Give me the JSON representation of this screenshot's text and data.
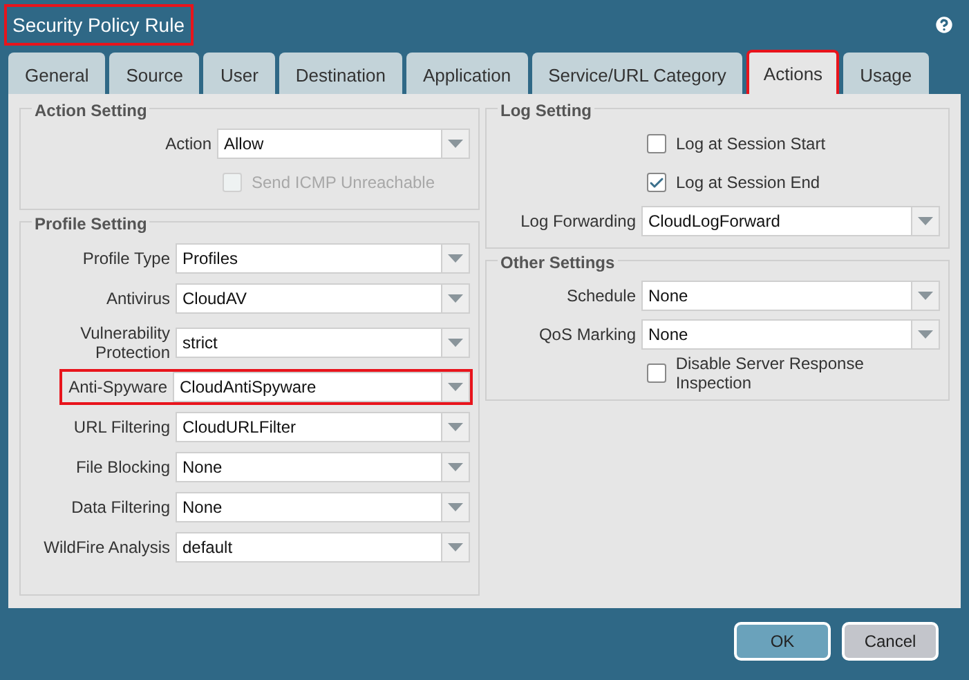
{
  "dialog": {
    "title": "Security Policy Rule",
    "highlighted": true
  },
  "tabs": [
    {
      "label": "General",
      "selected": false,
      "highlighted": false
    },
    {
      "label": "Source",
      "selected": false,
      "highlighted": false
    },
    {
      "label": "User",
      "selected": false,
      "highlighted": false
    },
    {
      "label": "Destination",
      "selected": false,
      "highlighted": false
    },
    {
      "label": "Application",
      "selected": false,
      "highlighted": false
    },
    {
      "label": "Service/URL Category",
      "selected": false,
      "highlighted": false
    },
    {
      "label": "Actions",
      "selected": true,
      "highlighted": true
    },
    {
      "label": "Usage",
      "selected": false,
      "highlighted": false
    }
  ],
  "action_setting": {
    "legend": "Action Setting",
    "action": {
      "label": "Action",
      "value": "Allow"
    },
    "checks": [
      {
        "label": "Send ICMP Unreachable",
        "checked": false,
        "disabled": true
      }
    ]
  },
  "profile_setting": {
    "legend": "Profile Setting",
    "rows": [
      {
        "label": "Profile Type",
        "value": "Profiles",
        "highlighted": false
      },
      {
        "label": "Antivirus",
        "value": "CloudAV",
        "highlighted": false
      },
      {
        "label": "Vulnerability Protection",
        "value": "strict",
        "highlighted": false
      },
      {
        "label": "Anti-Spyware",
        "value": "CloudAntiSpyware",
        "highlighted": true
      },
      {
        "label": "URL Filtering",
        "value": "CloudURLFilter",
        "highlighted": false
      },
      {
        "label": "File Blocking",
        "value": "None",
        "highlighted": false
      },
      {
        "label": "Data Filtering",
        "value": "None",
        "highlighted": false
      },
      {
        "label": "WildFire Analysis",
        "value": "default",
        "highlighted": false
      }
    ]
  },
  "log_setting": {
    "legend": "Log Setting",
    "checks": [
      {
        "label": "Log at Session Start",
        "checked": false,
        "disabled": false
      },
      {
        "label": "Log at Session End",
        "checked": true,
        "disabled": false
      }
    ],
    "forwarding": {
      "label": "Log Forwarding",
      "value": "CloudLogForward"
    }
  },
  "other_settings": {
    "legend": "Other Settings",
    "rows": [
      {
        "label": "Schedule",
        "value": "None",
        "highlighted": false
      },
      {
        "label": "QoS Marking",
        "value": "None",
        "highlighted": false
      }
    ],
    "checks": [
      {
        "label": "Disable Server Response Inspection",
        "checked": false,
        "disabled": false
      }
    ]
  },
  "buttons": [
    {
      "label": "OK",
      "kind": "primary"
    },
    {
      "label": "Cancel",
      "kind": "secondary"
    }
  ]
}
